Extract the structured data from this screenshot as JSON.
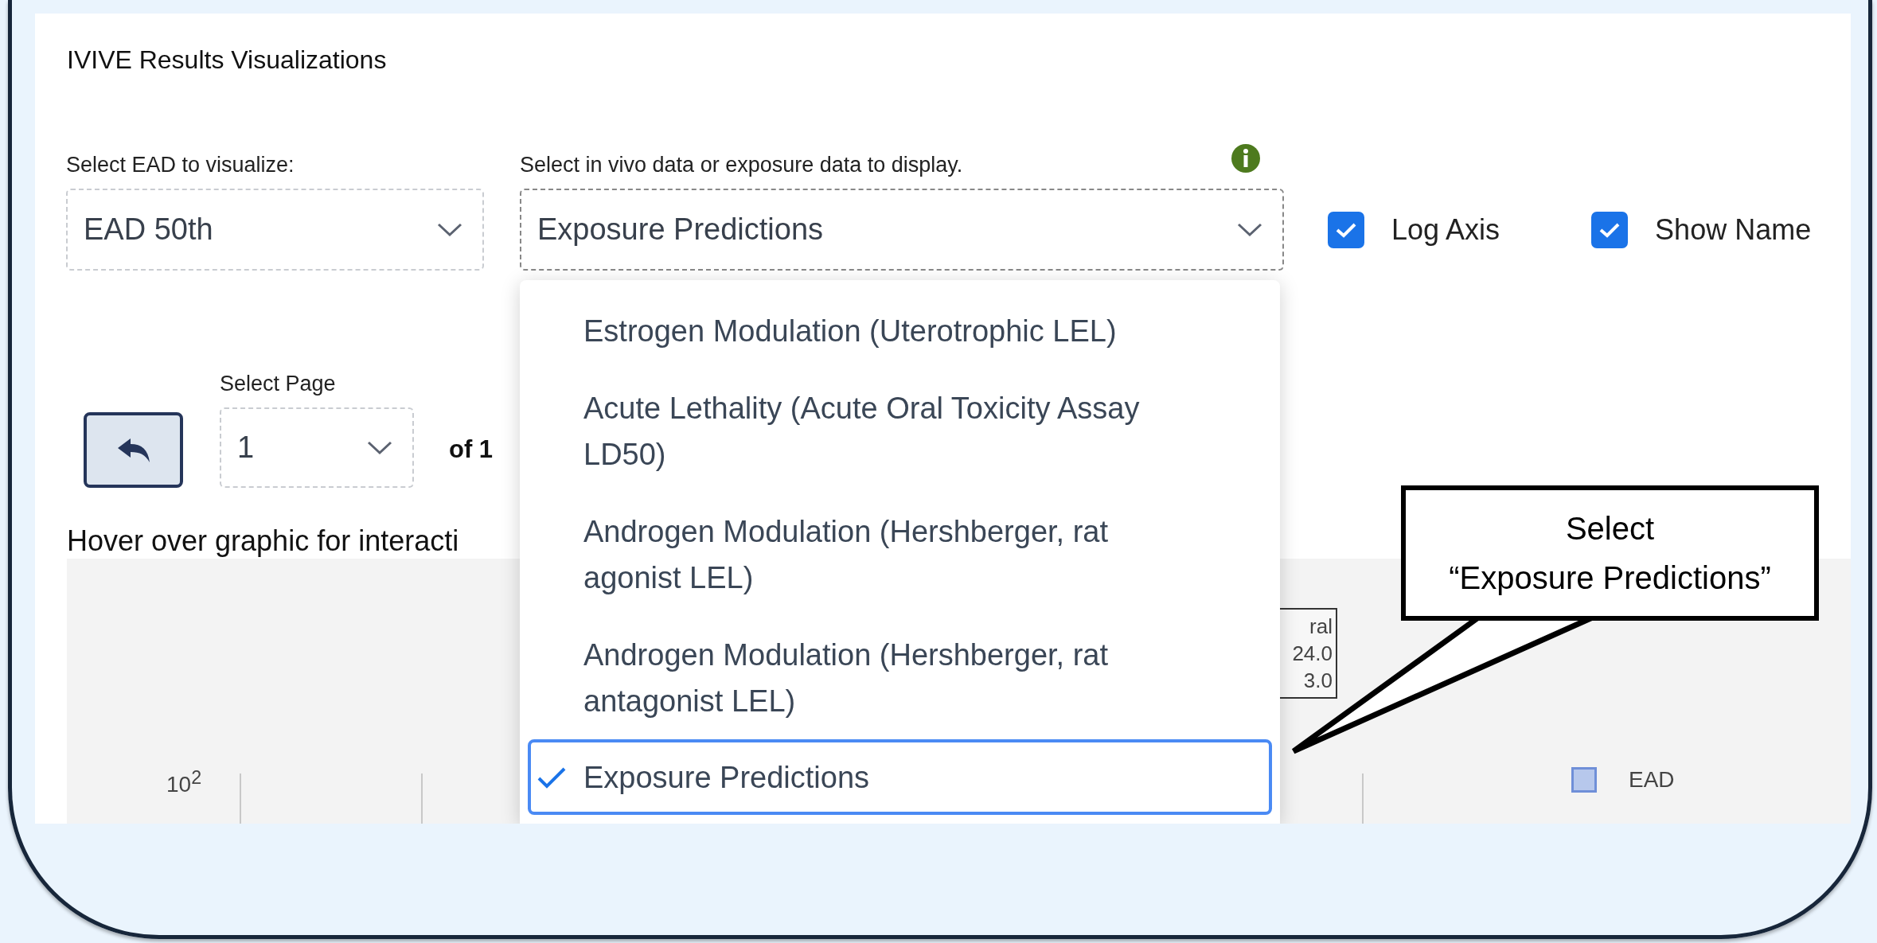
{
  "panel": {
    "title": "IVIVE Results Visualizations"
  },
  "ead_select": {
    "label": "Select EAD to visualize:",
    "value": "EAD 50th"
  },
  "data_select": {
    "label": "Select in vivo data or exposure data to display.",
    "value": "Exposure Predictions",
    "expanded": true,
    "options": [
      {
        "lines": [
          "Estrogen Modulation (Uterotrophic LEL)"
        ],
        "selected": false
      },
      {
        "lines": [
          "Acute Lethality (Acute Oral Toxicity Assay",
          "LD50)"
        ],
        "selected": false
      },
      {
        "lines": [
          "Androgen Modulation (Hershberger, rat",
          "agonist LEL)"
        ],
        "selected": false
      },
      {
        "lines": [
          "Androgen Modulation (Hershberger, rat",
          "antagonist LEL)"
        ],
        "selected": false
      },
      {
        "lines": [
          "Exposure Predictions"
        ],
        "selected": true
      }
    ]
  },
  "checkboxes": [
    {
      "label": "Log Axis",
      "checked": true
    },
    {
      "label": "Show Name",
      "checked": true
    }
  ],
  "pager": {
    "label": "Select Page",
    "value": "1",
    "total": "of 1"
  },
  "hint": "Hover over graphic for interacti",
  "chart": {
    "axis_label": "10$^{2}$",
    "tooltip": [
      "ral",
      "24.0",
      "3.0"
    ],
    "legend": [
      {
        "label": "EAD"
      }
    ]
  },
  "callout": {
    "lines": [
      "Select",
      "“Exposure Predictions”"
    ]
  }
}
